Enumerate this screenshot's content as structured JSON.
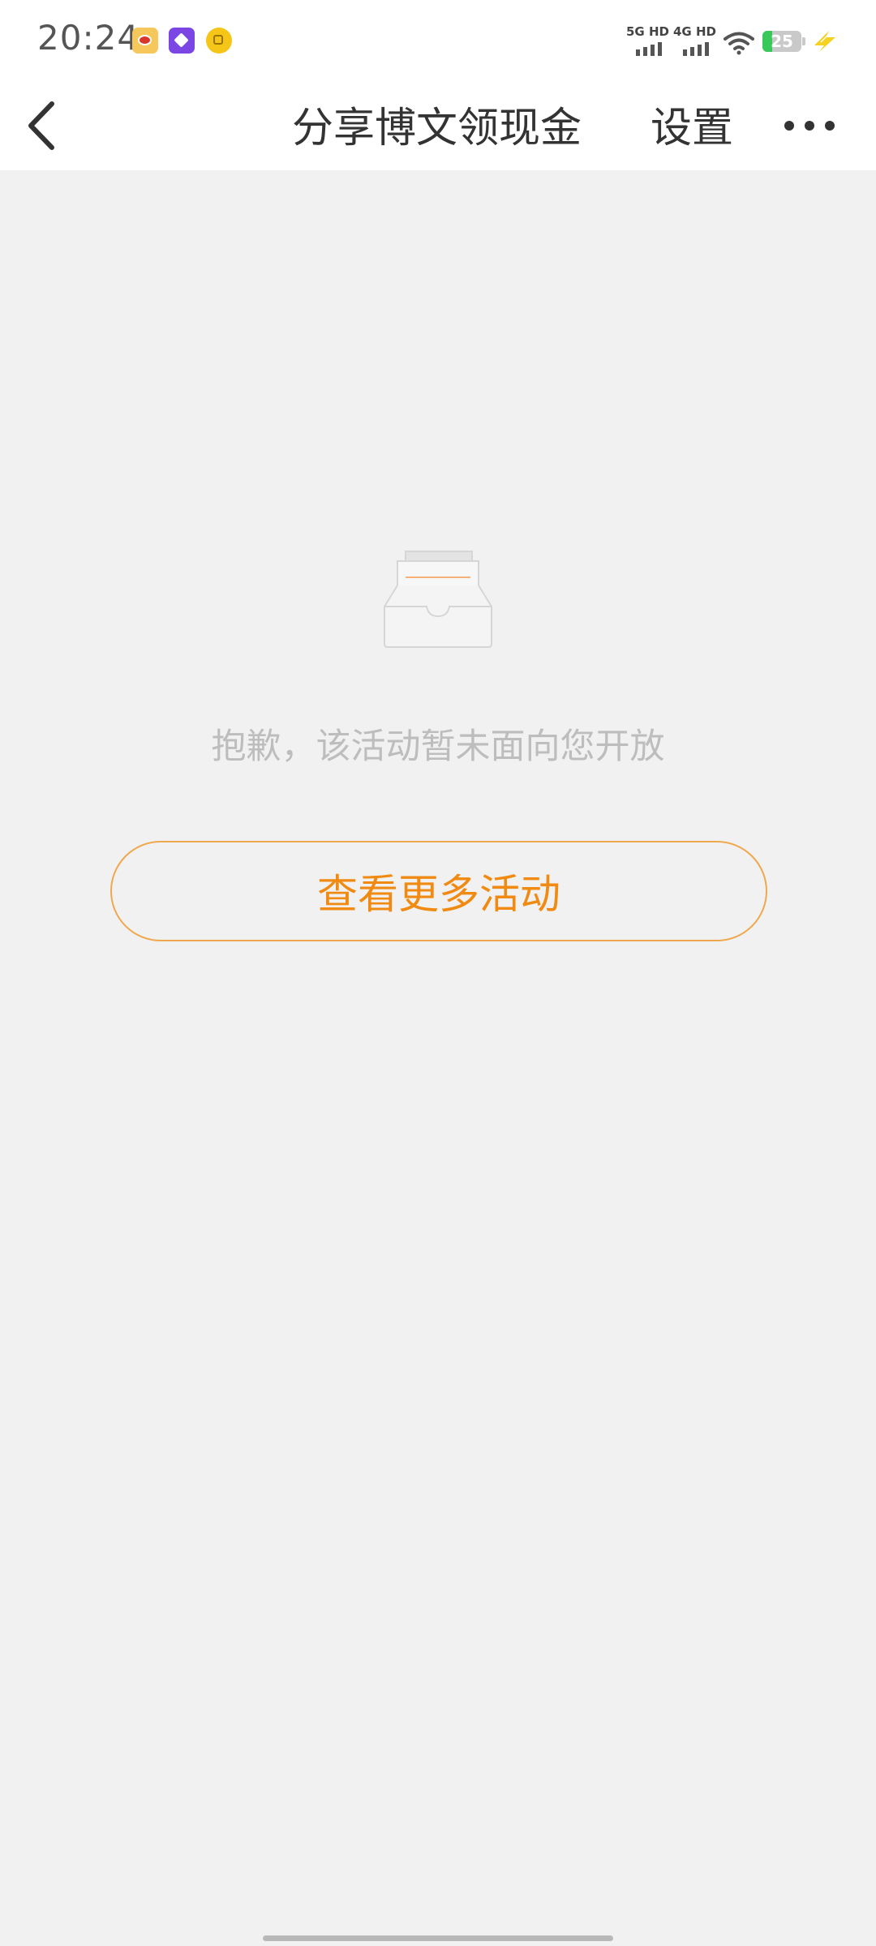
{
  "status_bar": {
    "time": "20:24",
    "notifications": [
      "weibo-icon",
      "purple-app-icon",
      "yellow-app-icon"
    ],
    "network_1": "5G HD",
    "network_2": "4G HD",
    "battery_level": 25,
    "battery_label": "25",
    "charging": true
  },
  "nav": {
    "title": "分享博文领现金",
    "settings_label": "设置"
  },
  "empty_state": {
    "illustration": "empty-tray-icon",
    "message": "抱歉，该活动暂未面向您开放"
  },
  "action": {
    "more_activities_label": "查看更多活动"
  },
  "colors": {
    "accent": "#f08a12",
    "button_border": "#f0a84e",
    "background": "#f1f1f1",
    "message_text": "#bdbdbd",
    "title_text": "#333333"
  }
}
